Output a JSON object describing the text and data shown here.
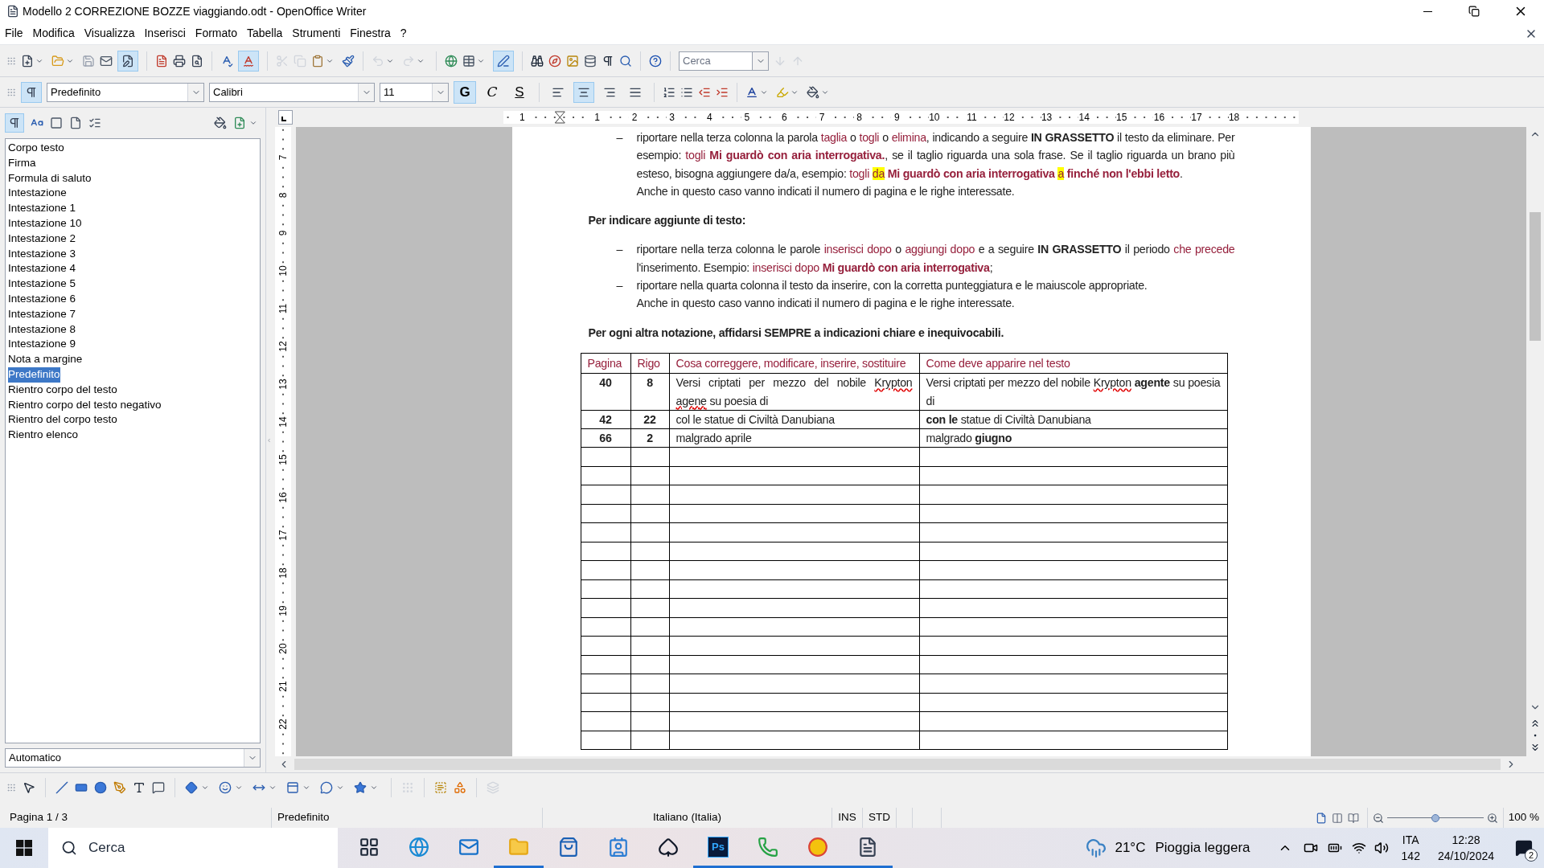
{
  "window": {
    "title": "Modello 2 CORREZIONE BOZZE viaggiando.odt - OpenOffice Writer"
  },
  "menu": [
    "File",
    "Modifica",
    "Visualizza",
    "Inserisci",
    "Formato",
    "Tabella",
    "Strumenti",
    "Finestra",
    "?"
  ],
  "standard_toolbar": {
    "search": {
      "placeholder": "Cerca"
    }
  },
  "format_toolbar": {
    "style": "Predefinito",
    "font": "Calibri",
    "size": "11",
    "char_buttons": [
      {
        "label": "G",
        "selected": true
      },
      {
        "label": "C",
        "selected": false
      },
      {
        "label": "S",
        "selected": false
      }
    ],
    "alignment": [
      {
        "selected": false
      },
      {
        "selected": true
      },
      {
        "selected": false
      },
      {
        "selected": false
      }
    ]
  },
  "styles_panel": {
    "items": [
      {
        "label": "Corpo testo",
        "selected": false
      },
      {
        "label": "Firma",
        "selected": false
      },
      {
        "label": "Formula di saluto",
        "selected": false
      },
      {
        "label": "Intestazione",
        "selected": false
      },
      {
        "label": "Intestazione 1",
        "selected": false
      },
      {
        "label": "Intestazione 10",
        "selected": false
      },
      {
        "label": "Intestazione 2",
        "selected": false
      },
      {
        "label": "Intestazione 3",
        "selected": false
      },
      {
        "label": "Intestazione 4",
        "selected": false
      },
      {
        "label": "Intestazione 5",
        "selected": false
      },
      {
        "label": "Intestazione 6",
        "selected": false
      },
      {
        "label": "Intestazione 7",
        "selected": false
      },
      {
        "label": "Intestazione 8",
        "selected": false
      },
      {
        "label": "Intestazione 9",
        "selected": false
      },
      {
        "label": "Nota a margine",
        "selected": false
      },
      {
        "label": "Predefinito",
        "selected": true
      },
      {
        "label": "Rientro corpo del testo",
        "selected": false
      },
      {
        "label": "Rientro corpo del testo negativo",
        "selected": false
      },
      {
        "label": "Rientro del corpo testo",
        "selected": false
      },
      {
        "label": "Rientro elenco",
        "selected": false
      }
    ],
    "filter": "Automatico"
  },
  "ruler": {
    "horizontal": [
      "1",
      "1",
      "2",
      "3",
      "4",
      "5",
      "6",
      "7",
      "8",
      "9",
      "10",
      "11",
      "12",
      "13",
      "14",
      "15",
      "16",
      "17",
      "18"
    ],
    "vertical": [
      "7",
      "8",
      "9",
      "10",
      "11",
      "12",
      "13",
      "14",
      "15",
      "16",
      "17",
      "18",
      "19",
      "20",
      "21",
      "22"
    ]
  },
  "document": {
    "blocks": [
      {
        "kind": "bullet",
        "marker": "–",
        "runs": [
          {
            "t": "riportare nella terza colonna la parola "
          },
          {
            "t": "taglia",
            "accent": true
          },
          {
            "t": " o "
          },
          {
            "t": "togli",
            "accent": true
          },
          {
            "t": " o "
          },
          {
            "t": "elimina",
            "accent": true
          },
          {
            "t": ", indicando a seguire "
          },
          {
            "t": "IN GRASSETTO",
            "bold": true
          },
          {
            "t": " il testo da eliminare. Per esempio: "
          },
          {
            "t": "togli ",
            "accent": true
          },
          {
            "t": "Mi guardò con aria interrogativa.",
            "accent": true,
            "bold": true
          },
          {
            "t": ", se il taglio riguarda una sola frase. Se il taglio riguarda un brano più esteso, bisogna aggiungere da/a, esempio: "
          },
          {
            "t": "togli ",
            "accent": true
          },
          {
            "t": "da",
            "accent": true,
            "highlight": true
          },
          {
            "t": " Mi guardò con aria interrogativa ",
            "accent": true,
            "bold": true
          },
          {
            "t": "a",
            "accent": true,
            "highlight": true
          },
          {
            "t": " finché non l'ebbi letto",
            "accent": true,
            "bold": true
          },
          {
            "t": "."
          }
        ]
      },
      {
        "kind": "indent",
        "runs": [
          {
            "t": "Anche in questo caso vanno indicati il numero di pagina e le righe interessate."
          }
        ]
      },
      {
        "kind": "heading",
        "runs": [
          {
            "t": "Per indicare aggiunte di testo:",
            "bold": true
          }
        ]
      },
      {
        "kind": "bullet",
        "marker": "–",
        "runs": [
          {
            "t": "riportare nella terza colonna le parole "
          },
          {
            "t": "inserisci dopo",
            "accent": true
          },
          {
            "t": " o "
          },
          {
            "t": "aggiungi dopo",
            "accent": true
          },
          {
            "t": " e a seguire "
          },
          {
            "t": "IN GRASSETTO",
            "bold": true
          },
          {
            "t": " il periodo "
          },
          {
            "t": "che precede",
            "accent": true
          },
          {
            "t": " l'inserimento. Esempio: "
          },
          {
            "t": "inserisci dopo ",
            "accent": true
          },
          {
            "t": "Mi guardò con aria interrogativa",
            "accent": true,
            "bold": true
          },
          {
            "t": ";"
          }
        ]
      },
      {
        "kind": "bullet",
        "marker": "–",
        "runs": [
          {
            "t": "riportare nella quarta colonna il testo da inserire, con la corretta punteggiatura e le maiuscole appropriate."
          }
        ]
      },
      {
        "kind": "indent",
        "runs": [
          {
            "t": "Anche in questo caso vanno indicati il numero di pagina e le righe interessate."
          }
        ]
      },
      {
        "kind": "heading",
        "runs": [
          {
            "t": "Per ogni altra notazione, affidarsi SEMPRE a indicazioni chiare e inequivocabili.",
            "bold": true
          }
        ]
      }
    ],
    "table": {
      "columns": [
        "Pagina",
        "Rigo",
        "Cosa correggere, modificare, inserire, sostituire",
        "Come deve apparire nel testo"
      ],
      "rows": [
        {
          "cells": [
            [
              {
                "t": "40",
                "bold": true
              }
            ],
            [
              {
                "t": "8",
                "bold": true
              }
            ],
            [
              {
                "t": "Versi criptati per mezzo del nobile "
              },
              {
                "t": "Krypton agene",
                "spell": true
              },
              {
                "t": " su poesia di"
              }
            ],
            [
              {
                "t": "Versi criptati per mezzo del nobile "
              },
              {
                "t": "Krypton",
                "spell": true
              },
              {
                "t": " agente",
                "bold": true
              },
              {
                "t": " su poesia di"
              }
            ]
          ]
        },
        {
          "cells": [
            [
              {
                "t": "42",
                "bold": true
              }
            ],
            [
              {
                "t": "22",
                "bold": true
              }
            ],
            [
              {
                "t": "col le statue di Civiltà Danubiana"
              }
            ],
            [
              {
                "t": "con le",
                "bold": true
              },
              {
                "t": " statue di Civiltà Danubiana"
              }
            ]
          ]
        },
        {
          "cells": [
            [
              {
                "t": "66",
                "bold": true
              }
            ],
            [
              {
                "t": "2",
                "bold": true
              }
            ],
            [
              {
                "t": "malgrado aprile"
              }
            ],
            [
              {
                "t": "malgrado "
              },
              {
                "t": "giugno",
                "bold": true
              }
            ]
          ]
        }
      ]
    }
  },
  "status_bar": {
    "page": "Pagina 1 / 3",
    "style": "Predefinito",
    "language": "Italiano (Italia)",
    "insert_mode": "INS",
    "selection_mode": "STD",
    "zoom_slider": {
      "level": 0.5
    },
    "zoom": "100 %"
  },
  "taskbar": {
    "search": {
      "placeholder": "Cerca"
    },
    "apps": [
      {
        "running": false
      },
      {
        "running": false
      },
      {
        "running": false
      },
      {
        "running": true
      },
      {
        "running": false
      },
      {
        "running": false
      },
      {
        "running": false
      },
      {
        "label": "Ps",
        "running": true
      },
      {
        "running": true
      },
      {
        "running": true
      },
      {
        "running": true
      }
    ],
    "weather": {
      "temperature": "21°C",
      "condition": "Pioggia leggera"
    },
    "language": "ITA",
    "language_sub": "142",
    "time": "12:28",
    "date": "24/10/2024",
    "notifications": "2"
  }
}
